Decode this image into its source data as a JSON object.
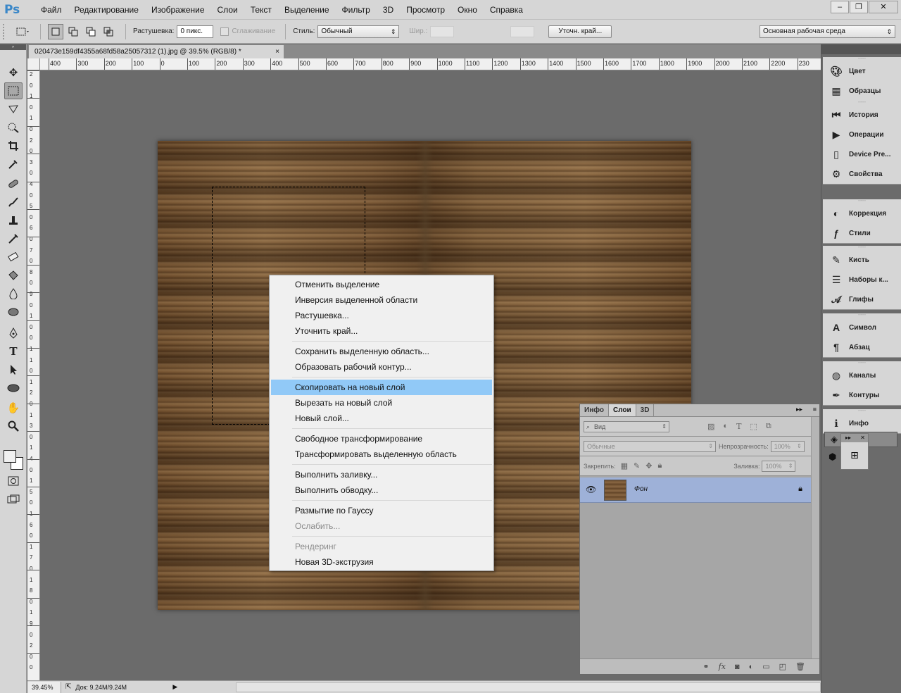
{
  "app": {
    "logo": "Ps"
  },
  "menubar": {
    "items": [
      "Файл",
      "Редактирование",
      "Изображение",
      "Слои",
      "Текст",
      "Выделение",
      "Фильтр",
      "3D",
      "Просмотр",
      "Окно",
      "Справка"
    ]
  },
  "window_controls": {
    "minimize": "–",
    "restore": "❐",
    "close": "✕"
  },
  "options": {
    "feather_label": "Растушевка:",
    "feather_value": "0 пикс.",
    "antialias_label": "Сглаживание",
    "style_label": "Стиль:",
    "style_value": "Обычный",
    "width_label": "Шир.:",
    "refine_edge_button": "Уточн. край...",
    "workspace_value": "Основная рабочая среда"
  },
  "document": {
    "tab_title": "020473e159df4355a68fd58a25057312 (1).jpg @ 39.5% (RGB/8) *",
    "tab_close": "×"
  },
  "rulers": {
    "top": [
      "400",
      "300",
      "200",
      "100",
      "0",
      "100",
      "200",
      "300",
      "400",
      "500",
      "600",
      "700",
      "800",
      "900",
      "1000",
      "1100",
      "1200",
      "1300",
      "1400",
      "1500",
      "1600",
      "1700",
      "1800",
      "1900",
      "2000",
      "2100",
      "2200",
      "230"
    ],
    "left": [
      "2",
      "0",
      "1",
      "0",
      "1",
      "0",
      "2",
      "0",
      "3",
      "0",
      "4",
      "0",
      "5",
      "0",
      "6",
      "0",
      "7",
      "0",
      "8",
      "0",
      "9",
      "0",
      "1",
      "0",
      "0",
      "1",
      "1",
      "0",
      "1",
      "2",
      "0",
      "1",
      "3",
      "0",
      "1",
      "4",
      "0",
      "1",
      "5",
      "0",
      "1",
      "6",
      "0",
      "1",
      "7",
      "0",
      "1",
      "8",
      "0",
      "1",
      "9",
      "0",
      "2",
      "0",
      "0"
    ]
  },
  "context_menu": {
    "groups": [
      [
        "Отменить выделение",
        "Инверсия выделенной области",
        "Растушевка...",
        "Уточнить край..."
      ],
      [
        "Сохранить выделенную область...",
        "Образовать рабочий контур..."
      ],
      [
        "Скопировать на новый слой",
        "Вырезать на новый слой",
        "Новый слой..."
      ],
      [
        "Свободное трансформирование",
        "Трансформировать выделенную область"
      ],
      [
        "Выполнить заливку...",
        "Выполнить обводку..."
      ],
      [
        "Размытие по Гауссу",
        "Ослабить..."
      ],
      [
        "Рендеринг",
        "Новая 3D-экструзия"
      ]
    ],
    "highlighted": "Скопировать на новый слой",
    "disabled": [
      "Ослабить...",
      "Рендеринг"
    ]
  },
  "dock": {
    "groups": [
      [
        {
          "icon": "palette-icon",
          "label": "Цвет"
        },
        {
          "icon": "swatches-icon",
          "label": "Образцы"
        }
      ],
      [
        {
          "icon": "history-icon",
          "label": "История"
        },
        {
          "icon": "actions-icon",
          "label": "Операции"
        },
        {
          "icon": "device-preview-icon",
          "label": "Device Pre..."
        },
        {
          "icon": "properties-icon",
          "label": "Свойства"
        }
      ],
      [
        {
          "icon": "adjustments-icon",
          "label": "Коррекция"
        },
        {
          "icon": "styles-icon",
          "label": "Стили"
        }
      ],
      [
        {
          "icon": "brush-icon",
          "label": "Кисть"
        },
        {
          "icon": "brush-presets-icon",
          "label": "Наборы к..."
        },
        {
          "icon": "glyphs-icon",
          "label": "Глифы"
        }
      ],
      [
        {
          "icon": "character-icon",
          "label": "Символ"
        },
        {
          "icon": "paragraph-icon",
          "label": "Абзац"
        }
      ],
      [
        {
          "icon": "channels-icon",
          "label": "Каналы"
        },
        {
          "icon": "paths-icon",
          "label": "Контуры"
        }
      ],
      [
        {
          "icon": "info-icon",
          "label": "Инфо"
        }
      ]
    ]
  },
  "layers_panel": {
    "tabs": [
      "Инфо",
      "Слои",
      "3D"
    ],
    "active_tab": "Слои",
    "filter_value": "Вид",
    "blend_mode": "Обычные",
    "opacity_label": "Непрозрачность:",
    "opacity_value": "100%",
    "lock_label": "Закрепить:",
    "fill_label": "Заливка:",
    "fill_value": "100%",
    "layer_name": "Фон"
  },
  "statusbar": {
    "zoom": "39.45%",
    "doc_info": "Док: 9.24M/9.24M"
  },
  "colors": {
    "accent_highlight": "#91c9f7",
    "selected_layer": "#9eb1d8",
    "ps_blue": "#3a87c8"
  }
}
